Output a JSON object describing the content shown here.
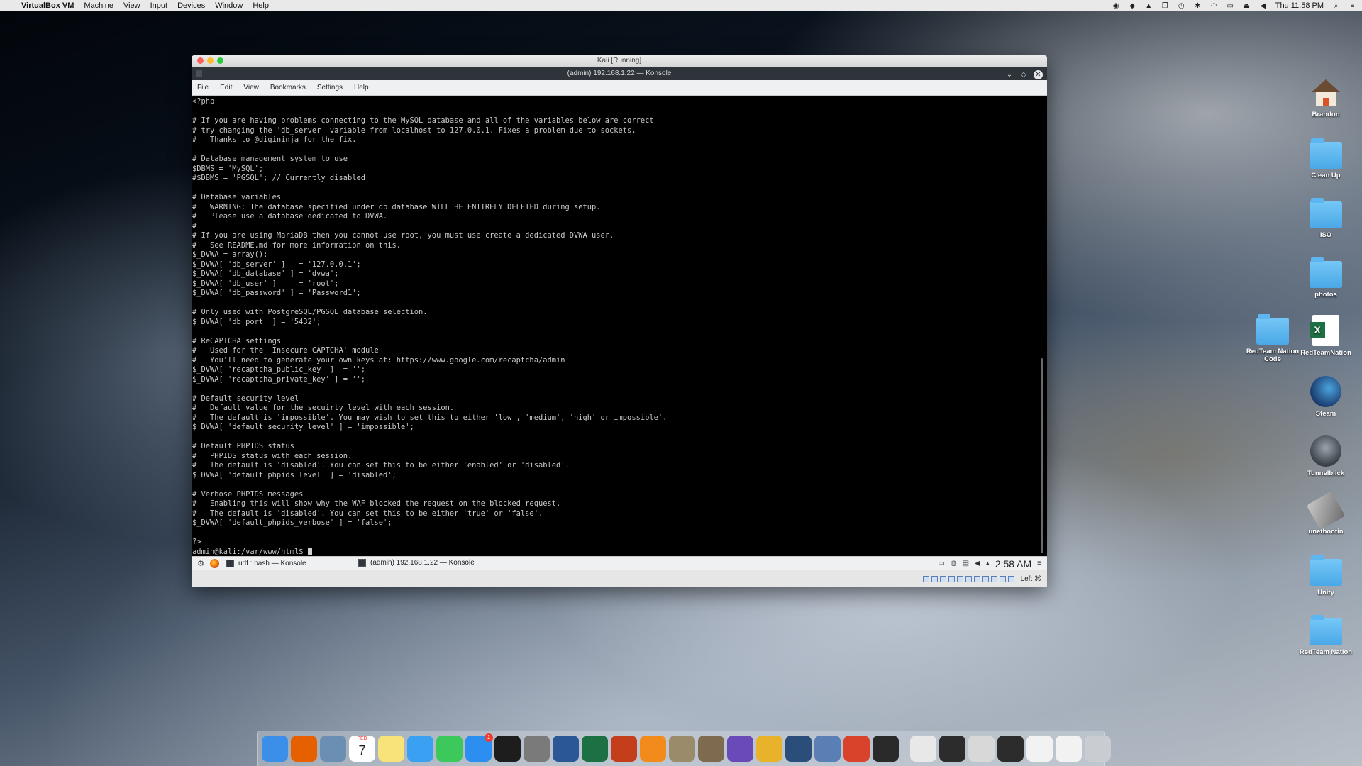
{
  "menubar": {
    "apple": "",
    "app_name": "VirtualBox VM",
    "items": [
      "Machine",
      "View",
      "Input",
      "Devices",
      "Window",
      "Help"
    ],
    "clock": "Thu 11:58 PM",
    "status_icons": [
      "screen-record-icon",
      "dropbox-icon",
      "google-drive-icon",
      "copy-icon",
      "time-machine-icon",
      "bluetooth-icon",
      "wifi-icon",
      "airplay-icon",
      "eject-icon",
      "volume-icon",
      "search-icon",
      "notification-center-icon"
    ]
  },
  "vm_window": {
    "title": "Kali [Running]",
    "konsole_title": "(admin) 192.168.1.22 — Konsole",
    "menu": [
      "File",
      "Edit",
      "View",
      "Bookmarks",
      "Settings",
      "Help"
    ],
    "terminal_lines": [
      "<?php",
      "",
      "# If you are having problems connecting to the MySQL database and all of the variables below are correct",
      "# try changing the 'db_server' variable from localhost to 127.0.0.1. Fixes a problem due to sockets.",
      "#   Thanks to @digininja for the fix.",
      "",
      "# Database management system to use",
      "$DBMS = 'MySQL';",
      "#$DBMS = 'PGSQL'; // Currently disabled",
      "",
      "# Database variables",
      "#   WARNING: The database specified under db_database WILL BE ENTIRELY DELETED during setup.",
      "#   Please use a database dedicated to DVWA.",
      "#",
      "# If you are using MariaDB then you cannot use root, you must use create a dedicated DVWA user.",
      "#   See README.md for more information on this.",
      "$_DVWA = array();",
      "$_DVWA[ 'db_server' ]   = '127.0.0.1';",
      "$_DVWA[ 'db_database' ] = 'dvwa';",
      "$_DVWA[ 'db_user' ]     = 'root';",
      "$_DVWA[ 'db_password' ] = 'Password1';",
      "",
      "# Only used with PostgreSQL/PGSQL database selection.",
      "$_DVWA[ 'db_port '] = '5432';",
      "",
      "# ReCAPTCHA settings",
      "#   Used for the 'Insecure CAPTCHA' module",
      "#   You'll need to generate your own keys at: https://www.google.com/recaptcha/admin",
      "$_DVWA[ 'recaptcha_public_key' ]  = '';",
      "$_DVWA[ 'recaptcha_private_key' ] = '';",
      "",
      "# Default security level",
      "#   Default value for the secuirty level with each session.",
      "#   The default is 'impossible'. You may wish to set this to either 'low', 'medium', 'high' or impossible'.",
      "$_DVWA[ 'default_security_level' ] = 'impossible';",
      "",
      "# Default PHPIDS status",
      "#   PHPIDS status with each session.",
      "#   The default is 'disabled'. You can set this to be either 'enabled' or 'disabled'.",
      "$_DVWA[ 'default_phpids_level' ] = 'disabled';",
      "",
      "# Verbose PHPIDS messages",
      "#   Enabling this will show why the WAF blocked the request on the blocked request.",
      "#   The default is 'disabled'. You can set this to be either 'true' or 'false'.",
      "$_DVWA[ 'default_phpids_verbose' ] = 'false';",
      "",
      "?>"
    ],
    "prompt": "admin@kali:/var/www/html$ ",
    "taskbar": {
      "task1": "udf : bash — Konsole",
      "task2": "(admin) 192.168.1.22 — Konsole",
      "clock": "2:58 AM"
    },
    "host_key": "Left ⌘"
  },
  "desktop_icons": [
    {
      "label": "Brandon",
      "type": "home"
    },
    {
      "label": "Clean Up",
      "type": "folder"
    },
    {
      "label": "ISO",
      "type": "folder"
    },
    {
      "label": "photos",
      "type": "folder"
    },
    {
      "label": "RedTeam Nation Code",
      "type": "folder"
    },
    {
      "label": "RedTeamNation",
      "type": "excel"
    },
    {
      "label": "Steam",
      "type": "steam"
    },
    {
      "label": "Tunnelblick",
      "type": "tunnelblick"
    },
    {
      "label": "unetbootin",
      "type": "unetbootin"
    },
    {
      "label": "Unity",
      "type": "folder"
    },
    {
      "label": "RedTeam Nation",
      "type": "folder"
    }
  ],
  "dock": {
    "apps": [
      {
        "name": "finder-icon",
        "color": "#3b8fe8"
      },
      {
        "name": "firefox-icon",
        "color": "#e66000"
      },
      {
        "name": "preview-icon",
        "color": "#6b8fb3"
      },
      {
        "name": "calendar-icon",
        "color": "#ffffff"
      },
      {
        "name": "notes-icon",
        "color": "#f7e37a"
      },
      {
        "name": "messages-icon",
        "color": "#3aa0f2"
      },
      {
        "name": "facetime-icon",
        "color": "#3cc85a"
      },
      {
        "name": "app-store-icon",
        "color": "#2b8ef0"
      },
      {
        "name": "terminal-icon",
        "color": "#1d1d1d"
      },
      {
        "name": "system-preferences-icon",
        "color": "#7a7a7a"
      },
      {
        "name": "word-icon",
        "color": "#2b5797"
      },
      {
        "name": "excel-icon",
        "color": "#1d7044"
      },
      {
        "name": "powerpoint-icon",
        "color": "#c43e1c"
      },
      {
        "name": "sublime-text-icon",
        "color": "#f28b1c"
      },
      {
        "name": "archive-utility-icon",
        "color": "#9a8b6b"
      },
      {
        "name": "gimp-icon",
        "color": "#7d6a4f"
      },
      {
        "name": "imovie-icon",
        "color": "#6a4ab8"
      },
      {
        "name": "chrome-icon",
        "color": "#e8b22a"
      },
      {
        "name": "quicktime-icon",
        "color": "#2a4d7a"
      },
      {
        "name": "virtualbox-icon",
        "color": "#5a7fb5"
      },
      {
        "name": "remote-desktop-icon",
        "color": "#d9432b"
      },
      {
        "name": "virtualbox-vm-icon",
        "color": "#2a2a2a"
      },
      {
        "name": "document-icon",
        "color": "#e8e8e8"
      },
      {
        "name": "terminal-window-icon",
        "color": "#2c2c2c"
      },
      {
        "name": "window-thumbnail-icon",
        "color": "#d8d8d8"
      },
      {
        "name": "terminal-window-icon",
        "color": "#2c2c2c"
      },
      {
        "name": "mail-window-icon",
        "color": "#f2f2f2"
      },
      {
        "name": "mail-window-icon",
        "color": "#f2f2f2"
      },
      {
        "name": "trash-icon",
        "color": "#c9ccd0"
      }
    ],
    "calendar_day": "7",
    "calendar_month": "FEB",
    "app_store_badge": "1"
  }
}
